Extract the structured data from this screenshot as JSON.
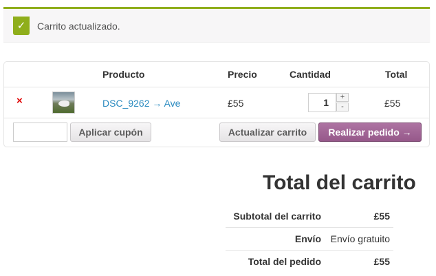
{
  "notice": {
    "icon": "checkmark-icon",
    "icon_glyph": "✓",
    "message": "Carrito actualizado.",
    "accent_color": "#8fae1b"
  },
  "cart": {
    "headers": {
      "product": "Producto",
      "price": "Precio",
      "quantity": "Cantidad",
      "total": "Total"
    },
    "items": [
      {
        "remove_glyph": "×",
        "thumbnail": "bird-photo-thumbnail",
        "product": "DSC_9262 → Ave",
        "price": "£55",
        "quantity": "1",
        "total": "£55"
      }
    ],
    "stepper": {
      "plus": "+",
      "minus": "-"
    },
    "coupon_placeholder": "",
    "apply_coupon": "Aplicar cupón",
    "update_cart": "Actualizar carrito",
    "checkout": "Realizar pedido →",
    "checkout_color": "#96588a"
  },
  "totals": {
    "title": "Total del carrito",
    "rows": [
      {
        "label": "Subtotal del carrito",
        "value": "£55"
      },
      {
        "label": "Envío",
        "value": "Envío gratuito"
      },
      {
        "label": "Total del pedido",
        "value": "£55"
      }
    ]
  }
}
